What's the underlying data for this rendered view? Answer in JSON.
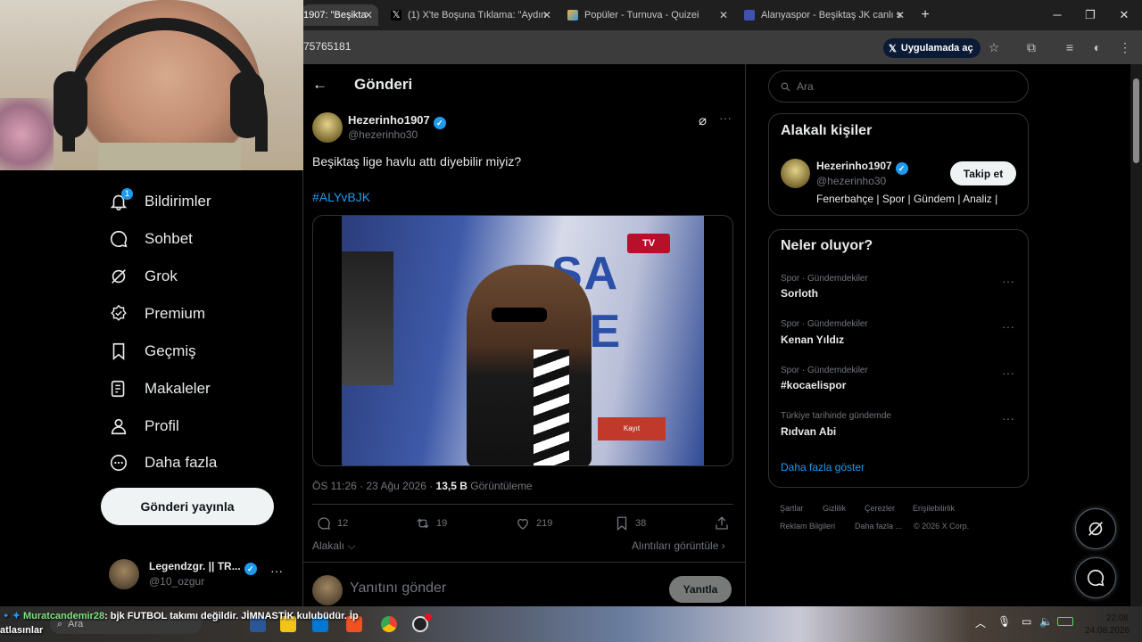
{
  "browser": {
    "tabs": [
      {
        "label": "1907: \"Beşikta"
      },
      {
        "label": "(1) X'te Boşuna Tıklama: \"Aydın"
      },
      {
        "label": "Popüler - Turnuva - Quizei"
      },
      {
        "label": "Alanyaspor - Beşiktaş JK canlı s"
      }
    ],
    "url": "75765181",
    "open_app_label": "Uygulamada aç"
  },
  "nav": {
    "items": [
      {
        "label": "Bildirimler",
        "icon": "bell-icon",
        "badge": "1"
      },
      {
        "label": "Sohbet",
        "icon": "chat-icon"
      },
      {
        "label": "Grok",
        "icon": "grok-icon"
      },
      {
        "label": "Premium",
        "icon": "premium-icon"
      },
      {
        "label": "Geçmiş",
        "icon": "bookmark-icon"
      },
      {
        "label": "Makaleler",
        "icon": "articles-icon"
      },
      {
        "label": "Profil",
        "icon": "profile-icon"
      },
      {
        "label": "Daha fazla",
        "icon": "more-circle-icon"
      }
    ],
    "post_button": "Gönderi yayınla",
    "account": {
      "name": "Legendzgr. || TR...",
      "handle": "@10_ozgur"
    }
  },
  "post": {
    "header_title": "Gönderi",
    "author_name": "Hezerinho1907",
    "author_handle": "@hezerinho30",
    "text": "Beşiktaş lige havlu attı diyebilir miyiz?",
    "hashtag": "#ALYvBJK",
    "video_caption": "Kayıt",
    "timestamp": "ÖS 11:26 · 23 Ağu 2026 · ",
    "views_count": "13,5 B",
    "views_label": " Görüntüleme",
    "replies": "12",
    "reposts": "19",
    "likes": "219",
    "bookmarks": "38",
    "relevant_label": "Alakalı",
    "quotes_label": "Alıntıları görüntüle",
    "reply_placeholder": "Yanıtını gönder",
    "reply_button": "Yanıtla"
  },
  "sidebar": {
    "search_placeholder": "Ara",
    "related_title": "Alakalı kişiler",
    "related_person": {
      "name": "Hezerinho1907",
      "handle": "@hezerinho30",
      "bio": "Fenerbahçe | Spor | Gündem | Analiz |",
      "follow_label": "Takip et"
    },
    "trends_title": "Neler oluyor?",
    "trends": [
      {
        "category": "Spor · Gündemdekiler",
        "name": "Sorloth"
      },
      {
        "category": "Spor · Gündemdekiler",
        "name": "Kenan Yıldız"
      },
      {
        "category": "Spor · Gündemdekiler",
        "name": "#kocaelispor"
      },
      {
        "category": "Türkiye tarihinde gündemde",
        "name": "Rıdvan Abi"
      }
    ],
    "show_more": "Daha fazla göster",
    "footer": [
      "Şartlar",
      "Gizlilik",
      "Çerezler",
      "Erişilebilirlik",
      "Reklam Bilgileri",
      "Daha fazla ...",
      "© 2026 X Corp."
    ]
  },
  "overlay": {
    "chat_user": "Muratcandemir28",
    "chat_message": ": bjk FUTBOL takımı değildir. JİMNASTİK kulubüdür. İp",
    "chat_message_2": "atlasınlar"
  },
  "taskbar": {
    "search_placeholder": "Ara",
    "time": "22:06",
    "date": "24.08.2026"
  },
  "colors": {
    "accent": "#1d9bf0",
    "background": "#000000",
    "border": "#2f3336",
    "muted": "#71767b"
  }
}
